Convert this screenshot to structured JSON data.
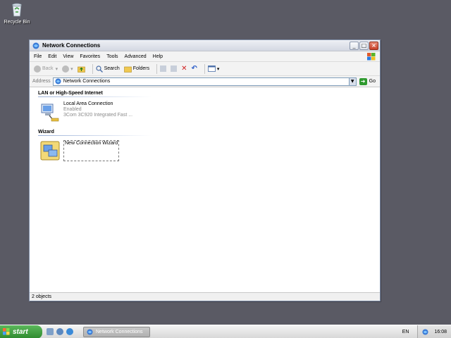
{
  "desktop": {
    "recycle_bin_label": "Recycle Bin"
  },
  "window": {
    "title": "Network Connections",
    "menu": [
      "File",
      "Edit",
      "View",
      "Favorites",
      "Tools",
      "Advanced",
      "Help"
    ],
    "toolbar": {
      "back": "Back",
      "search": "Search",
      "folders": "Folders"
    },
    "address": {
      "label": "Address",
      "value": "Network Connections",
      "go": "Go"
    },
    "groups": [
      {
        "header": "LAN or High-Speed Internet",
        "item": {
          "name": "Local Area Connection",
          "status": "Enabled",
          "device": "3Com 3C920 Integrated Fast ..."
        }
      },
      {
        "header": "Wizard",
        "item": {
          "name": "New Connection Wizard"
        }
      }
    ],
    "status_text": "2 objects"
  },
  "taskbar": {
    "start_label": "start",
    "task_label": "Network Connections",
    "language": "EN",
    "clock": "16:08"
  }
}
